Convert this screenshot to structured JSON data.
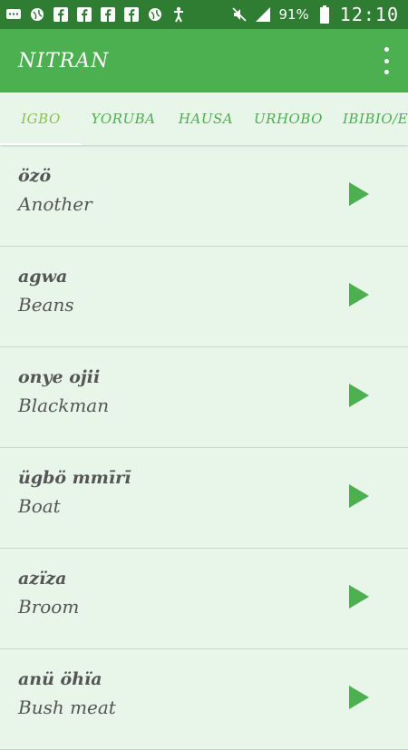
{
  "status_bar": {
    "icons": [
      "message-icon",
      "globe-icon",
      "facebook-icon",
      "facebook-icon",
      "facebook-icon",
      "facebook-icon",
      "globe-icon",
      "accessibility-icon"
    ],
    "battery": "91%",
    "time": "12:10"
  },
  "app": {
    "title": "NITRAN"
  },
  "tabs": [
    "IGBO",
    "YORUBA",
    "HAUSA",
    "URHOBO",
    "IBIBIO/E"
  ],
  "active_tab": "IGBO",
  "words": [
    {
      "native": "özö",
      "english": "Another"
    },
    {
      "native": "agwa",
      "english": "Beans"
    },
    {
      "native": "onye ojii",
      "english": "Blackman"
    },
    {
      "native": "ügbö mmīrī",
      "english": "Boat"
    },
    {
      "native": "azïza",
      "english": "Broom"
    },
    {
      "native": "anü öhïa",
      "english": "Bush meat"
    }
  ],
  "colors": {
    "status": "#2e7d32",
    "appbar": "#4caf50",
    "background": "#e8f5e9",
    "active_tab": "#8bc34a"
  }
}
